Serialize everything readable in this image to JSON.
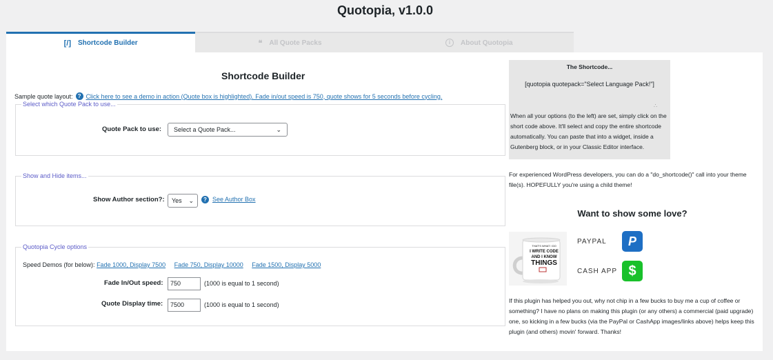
{
  "page_title": "Quotopia, v1.0.0",
  "tabs": [
    {
      "icon": "[/]",
      "label": "Shortcode Builder"
    },
    {
      "icon": "❝",
      "label": "All Quote Packs"
    },
    {
      "icon": "i",
      "label": "About Quotopia"
    }
  ],
  "builder": {
    "heading": "Shortcode Builder",
    "sample_label": "Sample quote layout:",
    "sample_link": "Click here to see a demo in action (Quote box is highlighted). Fade in/out speed is 750, quote shows for 5 seconds before cycling.",
    "pack_section": {
      "legend": "Select which Quote Pack to use...",
      "label": "Quote Pack to use:",
      "selected": "Select a Quote Pack..."
    },
    "author_section": {
      "legend": "Show and Hide items...",
      "label": "Show Author section?:",
      "selected": "Yes",
      "link": "See Author Box"
    },
    "cycle_section": {
      "legend": "Quotopia Cycle options",
      "speed_label": "Speed Demos (for below):",
      "speed_links": [
        "Fade 1000, Display 7500",
        "Fade 750, Display 10000",
        "Fade 1500, Display 5000"
      ],
      "fade_label": "Fade In/Out speed:",
      "fade_value": "750",
      "fade_hint": "(1000 is equal to 1 second)",
      "display_label": "Quote Display time:",
      "display_value": "7500",
      "display_hint": "(1000 is equal to 1 second)"
    }
  },
  "sidebar": {
    "shortcode_title": "The Shortcode...",
    "shortcode_value": "[quotopia quotepack=\"Select Language Pack!\"]",
    "shortcode_help": "When all your options (to the left) are set, simply click on the short code above. It'll select and copy the entire shortcode automatically. You can paste that into a widget, inside a Gutenberg block, or in your Classic Editor interface.",
    "dev_text": "For experienced WordPress developers, you can do a \"do_shortcode()\" call into your theme file(s). HOPEFULLY you're using a child theme!",
    "love_heading": "Want to show some love?",
    "mug_text": [
      "THAT'S WHAT I DO",
      "I WRITE CODE",
      "AND I KNOW",
      "THINGS"
    ],
    "paypal_label": "PAYPAL",
    "cashapp_label": "CASH APP",
    "love_text": "If this plugin has helped you out, why not chip in a few bucks to buy me a cup of coffee or something?  I have no plans on making this plugin (or any others) a commercial (paid upgrade) one, so kicking in a few bucks (via the PayPal or CashApp images/links above) helps keep this plugin (and others) movin' forward.  Thanks!"
  },
  "colors": {
    "accent": "#2271b1",
    "paypal": "#1e6fc4",
    "cashapp": "#19c12b",
    "legend": "#5c5cc8"
  }
}
